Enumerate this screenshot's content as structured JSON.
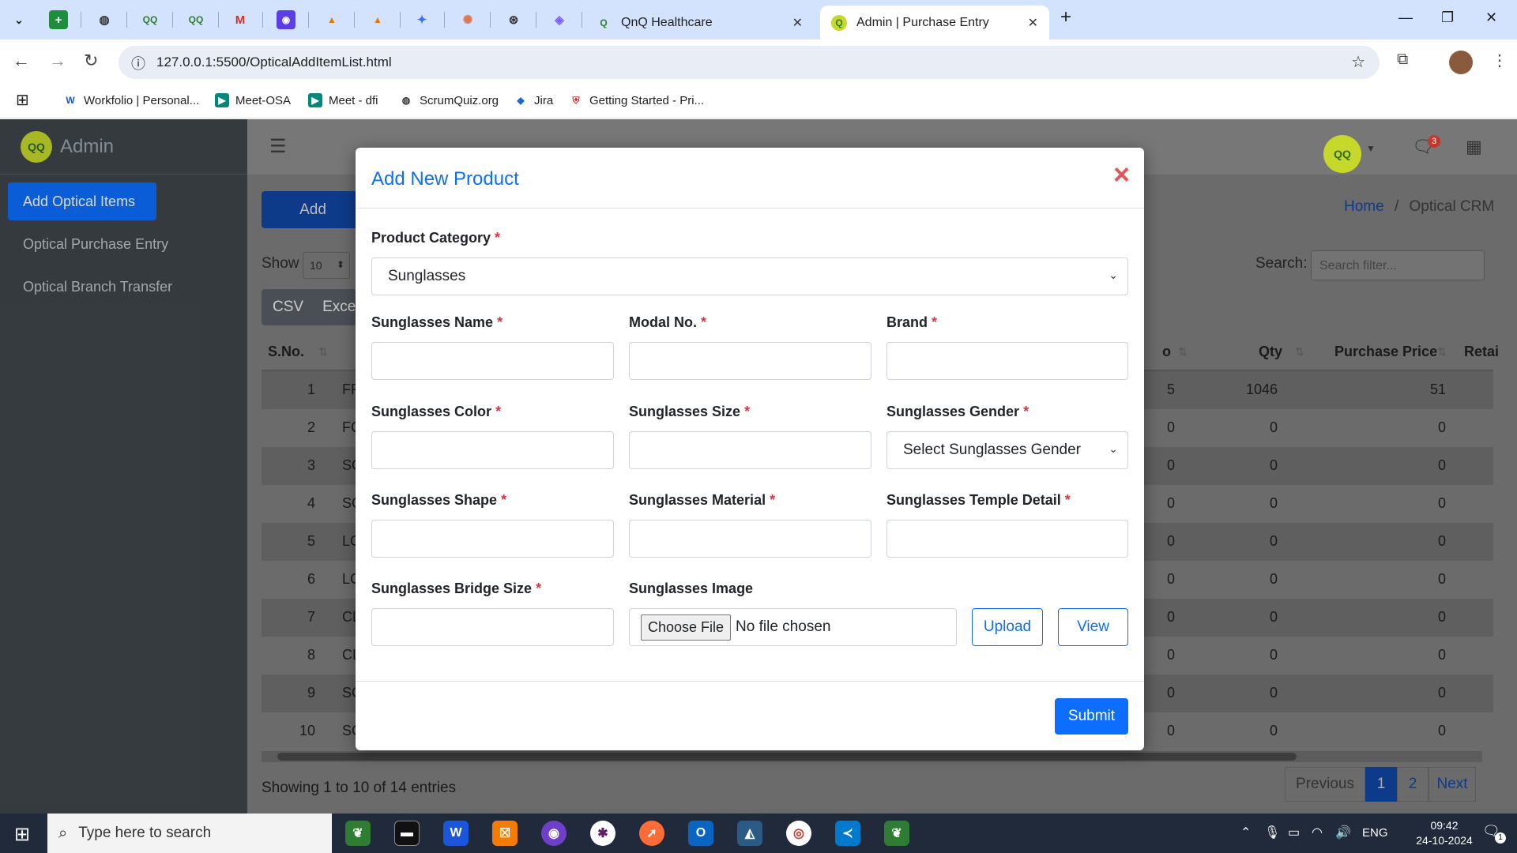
{
  "browser": {
    "tabs": [
      {
        "label": "QnQ Healthcare"
      },
      {
        "label": "Admin | Purchase Entry"
      }
    ],
    "url": "127.0.0.1:5500/OpticalAddItemList.html",
    "bookmarks": [
      {
        "label": "Workfolio | Personal..."
      },
      {
        "label": "Meet-OSA"
      },
      {
        "label": "Meet - dfi"
      },
      {
        "label": "ScrumQuiz.org"
      },
      {
        "label": "Jira"
      },
      {
        "label": "Getting Started - Pri..."
      }
    ]
  },
  "sidebar": {
    "brand": "Admin",
    "items": [
      {
        "label": "Add Optical Items"
      },
      {
        "label": "Optical Purchase Entry"
      },
      {
        "label": "Optical Branch Transfer"
      }
    ]
  },
  "page": {
    "add_button": "Add",
    "notification_count": "3",
    "breadcrumb_home": "Home",
    "breadcrumb_sep": "/",
    "breadcrumb_current": "Optical CRM",
    "show_label": "Show",
    "show_value": "10",
    "search_label": "Search:",
    "search_placeholder": "Search filter...",
    "export_buttons": [
      "CSV",
      "Exce"
    ],
    "columns": {
      "sno": "S.No.",
      "hidden_col": "o",
      "qty": "Qty",
      "purchase_price": "Purchase Price",
      "retail": "Retai"
    },
    "rows": [
      {
        "sno": "1",
        "code": "FF",
        "c": "5",
        "qty": "1046",
        "price": "51"
      },
      {
        "sno": "2",
        "code": "FC",
        "c": "0",
        "qty": "0",
        "price": "0"
      },
      {
        "sno": "3",
        "code": "SC",
        "c": "0",
        "qty": "0",
        "price": "0"
      },
      {
        "sno": "4",
        "code": "SC",
        "c": "0",
        "qty": "0",
        "price": "0"
      },
      {
        "sno": "5",
        "code": "LC",
        "c": "0",
        "qty": "0",
        "price": "0"
      },
      {
        "sno": "6",
        "code": "LC",
        "c": "0",
        "qty": "0",
        "price": "0"
      },
      {
        "sno": "7",
        "code": "CL",
        "c": "0",
        "qty": "0",
        "price": "0"
      },
      {
        "sno": "8",
        "code": "CL",
        "c": "0",
        "qty": "0",
        "price": "0"
      },
      {
        "sno": "9",
        "code": "SC",
        "c": "0",
        "qty": "0",
        "price": "0"
      },
      {
        "sno": "10",
        "code": "SC",
        "c": "0",
        "qty": "0",
        "price": "0"
      }
    ],
    "entries_info": "Showing 1 to 10 of 14 entries",
    "pagination": {
      "previous": "Previous",
      "page1": "1",
      "page2": "2",
      "next": "Next"
    }
  },
  "modal": {
    "title": "Add New Product",
    "close": "×",
    "category_label": "Product Category",
    "category_value": "Sunglasses",
    "required_mark": "*",
    "fields": {
      "name": "Sunglasses Name",
      "modal_no": "Modal No.",
      "brand": "Brand",
      "color": "Sunglasses Color",
      "size": "Sunglasses Size",
      "gender": "Sunglasses Gender",
      "gender_value": "Select Sunglasses Gender",
      "shape": "Sunglasses Shape",
      "material": "Sunglasses Material",
      "temple": "Sunglasses Temple Detail",
      "bridge": "Sunglasses Bridge Size",
      "image": "Sunglasses Image"
    },
    "file_button": "Choose File",
    "file_status": "No file chosen",
    "upload": "Upload",
    "view": "View",
    "submit": "Submit"
  },
  "taskbar": {
    "search_placeholder": "Type here to search",
    "time": "09:42",
    "date": "24-10-2024",
    "lang": "ENG",
    "notif": "1"
  }
}
